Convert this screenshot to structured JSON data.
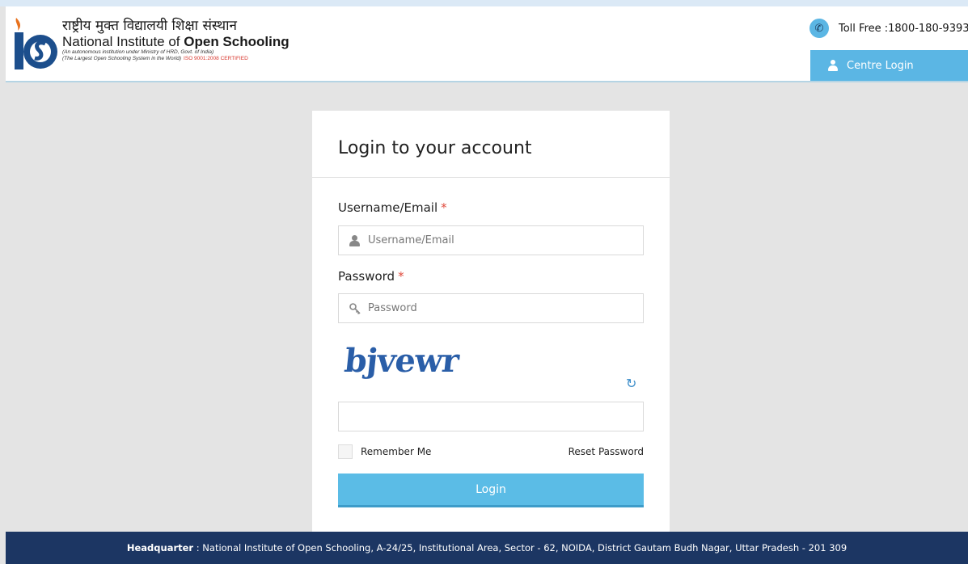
{
  "header": {
    "hindi_name": "राष्ट्रीय मुक्त विद्यालयी शिक्षा संस्थान",
    "name_prefix": "National Institute of ",
    "name_bold": "Open Schooling",
    "subline1": "(An autonomous institution under Ministry of HRD, Govt. of India)",
    "subline2": "(The Largest Open Schooling System in the World)",
    "iso": "ISO 9001:2008 CERTIFIED",
    "toll_free": "Toll Free :1800-180-9393",
    "centre_login": "Centre Login"
  },
  "login": {
    "title": "Login to your account",
    "username_label": "Username/Email",
    "username_placeholder": "Username/Email",
    "password_label": "Password",
    "password_placeholder": "Password",
    "required_mark": "*",
    "captcha_text": "bjvewr",
    "captcha_value": "",
    "remember_me": "Remember Me",
    "reset_password": "Reset Password",
    "login_button": "Login"
  },
  "footer": {
    "label": "Headquarter",
    "separator": " : ",
    "address": "National Institute of Open Schooling, A-24/25, Institutional Area, Sector - 62, NOIDA, District Gautam Budh Nagar, Uttar Pradesh - 201 309"
  },
  "icons": {
    "phone": "phone-icon",
    "user": "user-icon",
    "key": "key-icon",
    "refresh": "refresh-icon"
  },
  "colors": {
    "accent": "#5bb6e4",
    "footer_bg": "#1c3663",
    "required": "#e04a3c",
    "captcha": "#2a5ea8"
  }
}
